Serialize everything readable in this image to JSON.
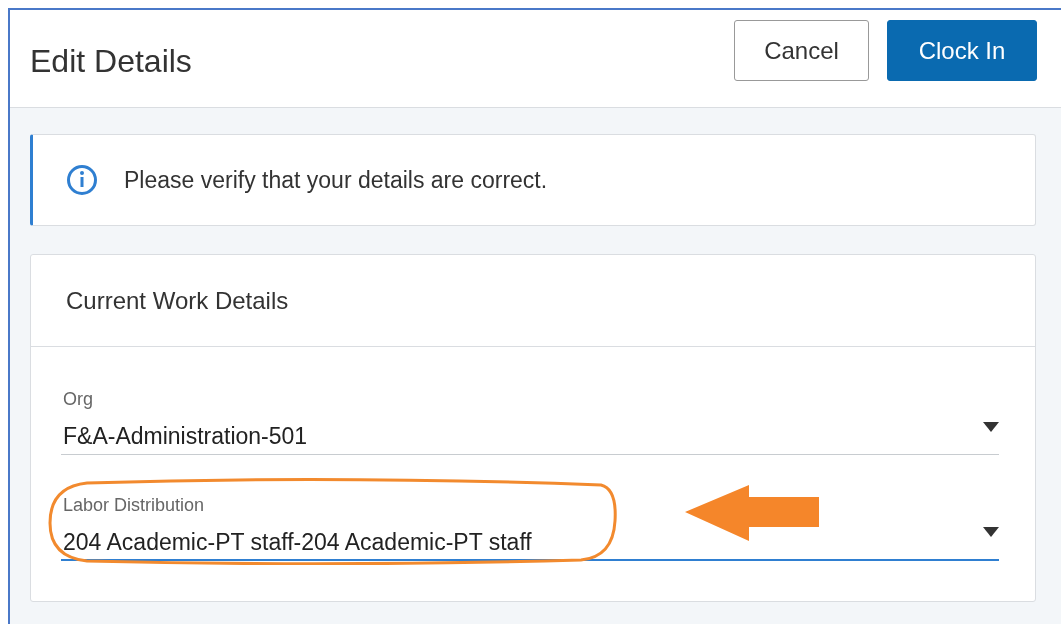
{
  "dialog": {
    "title": "Edit Details",
    "buttons": [
      {
        "label": "Cancel",
        "kind": "secondary"
      },
      {
        "label": "Clock In",
        "kind": "primary"
      }
    ]
  },
  "notice": {
    "text": "Please verify that your details are correct."
  },
  "section": {
    "title": "Current Work Details",
    "fields": [
      {
        "label": "Org",
        "value": "F&A-Administration-501",
        "focused": false,
        "highlighted": false
      },
      {
        "label": "Labor Distribution",
        "value": "204 Academic-PT staff-204 Academic-PT staff",
        "focused": true,
        "highlighted": true
      }
    ]
  }
}
